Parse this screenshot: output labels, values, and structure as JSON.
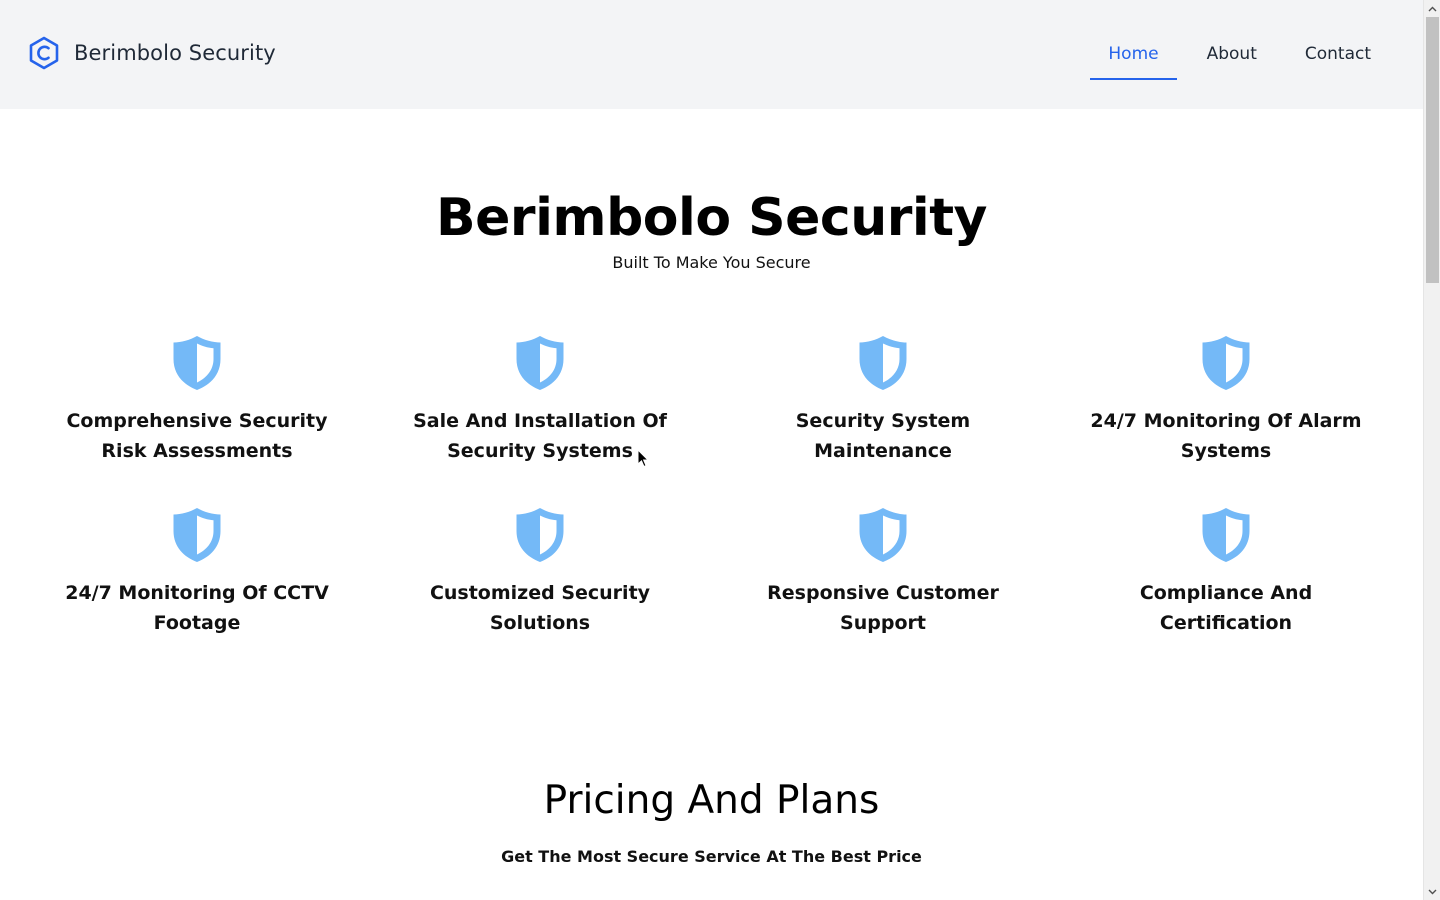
{
  "header": {
    "brand_name": "Berimbolo Security",
    "logo_icon": "hexagon-c-logo-icon",
    "nav": [
      {
        "label": "Home",
        "active": true
      },
      {
        "label": "About",
        "active": false
      },
      {
        "label": "Contact",
        "active": false
      }
    ]
  },
  "hero": {
    "title": "Berimbolo Security",
    "subtitle": "Built To Make You Secure"
  },
  "features": {
    "icon": "shield-icon",
    "items": [
      {
        "title": "Comprehensive Security Risk Assessments"
      },
      {
        "title": "Sale And Installation Of Security Systems"
      },
      {
        "title": "Security System Maintenance"
      },
      {
        "title": "24/7 Monitoring Of Alarm Systems"
      },
      {
        "title": "24/7 Monitoring Of CCTV Footage"
      },
      {
        "title": "Customized Security Solutions"
      },
      {
        "title": "Responsive Customer Support"
      },
      {
        "title": "Compliance And Certification"
      }
    ]
  },
  "pricing": {
    "title": "Pricing And Plans",
    "subtitle": "Get The Most Secure Service At The Best Price"
  },
  "colors": {
    "accent": "#2563eb",
    "shield": "#74b9f7",
    "header_bg": "#f3f4f6"
  }
}
